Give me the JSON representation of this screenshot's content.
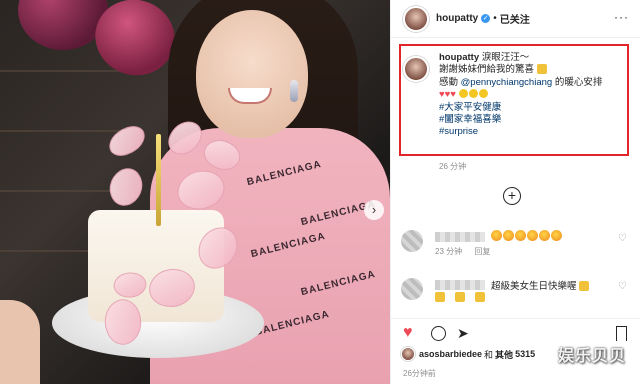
{
  "header": {
    "username": "houpatty",
    "verified": "✓",
    "separator": "•",
    "follow_status": "已关注",
    "more_icon": "···"
  },
  "caption": {
    "username": "houpatty",
    "line1": "淚眼汪汪～",
    "line2": "謝謝姊妹們給我的驚喜",
    "line3_prefix": "感動",
    "mention": "@pennychiangchiang",
    "line3_suffix": "的暖心安排",
    "hearts": "♥♥♥",
    "hashtags": [
      "#大家平安健康",
      "#闔家幸福喜樂",
      "#surprise"
    ],
    "time": "26 分钟"
  },
  "comments": [
    {
      "time": "23 分钟",
      "reply": "回复",
      "heart": "♡"
    },
    {
      "text": "超級美女生日快樂喔",
      "time": "23 分钟",
      "reply": "回复",
      "heart": "♡"
    }
  ],
  "actions": {
    "like_icon": "heart-icon",
    "comment_icon": "comment-icon",
    "share_icon": "share-icon",
    "save_icon": "bookmark-icon"
  },
  "likes": {
    "user": "asosbarbiedee",
    "conj": "和",
    "others_label": "其他",
    "count": "5315"
  },
  "post_time": "26分钟前",
  "photo": {
    "brand_text": "BALENCIAGA",
    "next_arrow": "›"
  },
  "watermark": "娱乐贝贝",
  "colors": {
    "accent": "#3897f0",
    "highlight_box": "#e2242b",
    "like": "#ed4956",
    "link": "#00376b"
  }
}
